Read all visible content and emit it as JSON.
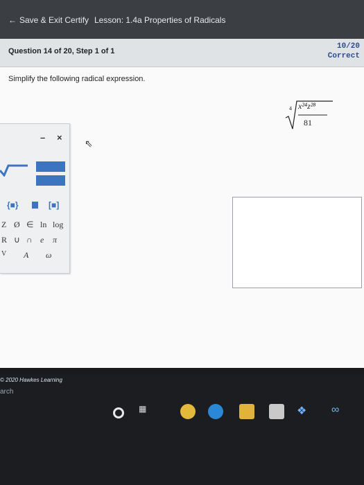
{
  "header": {
    "back_label": "Save & Exit Certify",
    "lesson_title": "Lesson: 1.4a Properties of Radicals"
  },
  "question": {
    "title": "Question 14 of 20, Step 1 of 1",
    "score": "10/20",
    "status": "Correct",
    "instruction": "Simplify the following radical expression."
  },
  "expression": {
    "index": "4",
    "numerator": "x²⁴z²⁸",
    "denominator": "81"
  },
  "palette": {
    "minimize": "–",
    "close": "×",
    "symbols_row3": [
      "Z",
      "Ø",
      "∈",
      "ln",
      "log"
    ],
    "symbols_row4": [
      "R",
      "∪",
      "∩",
      "e",
      "π"
    ],
    "symbols_row5": [
      "V",
      "A",
      "ω"
    ]
  },
  "footer": {
    "copyright": "© 2020 Hawkes Learning",
    "search": "arch"
  },
  "colors": {
    "accent": "#3d74c0",
    "score": "#2b4b8a"
  }
}
